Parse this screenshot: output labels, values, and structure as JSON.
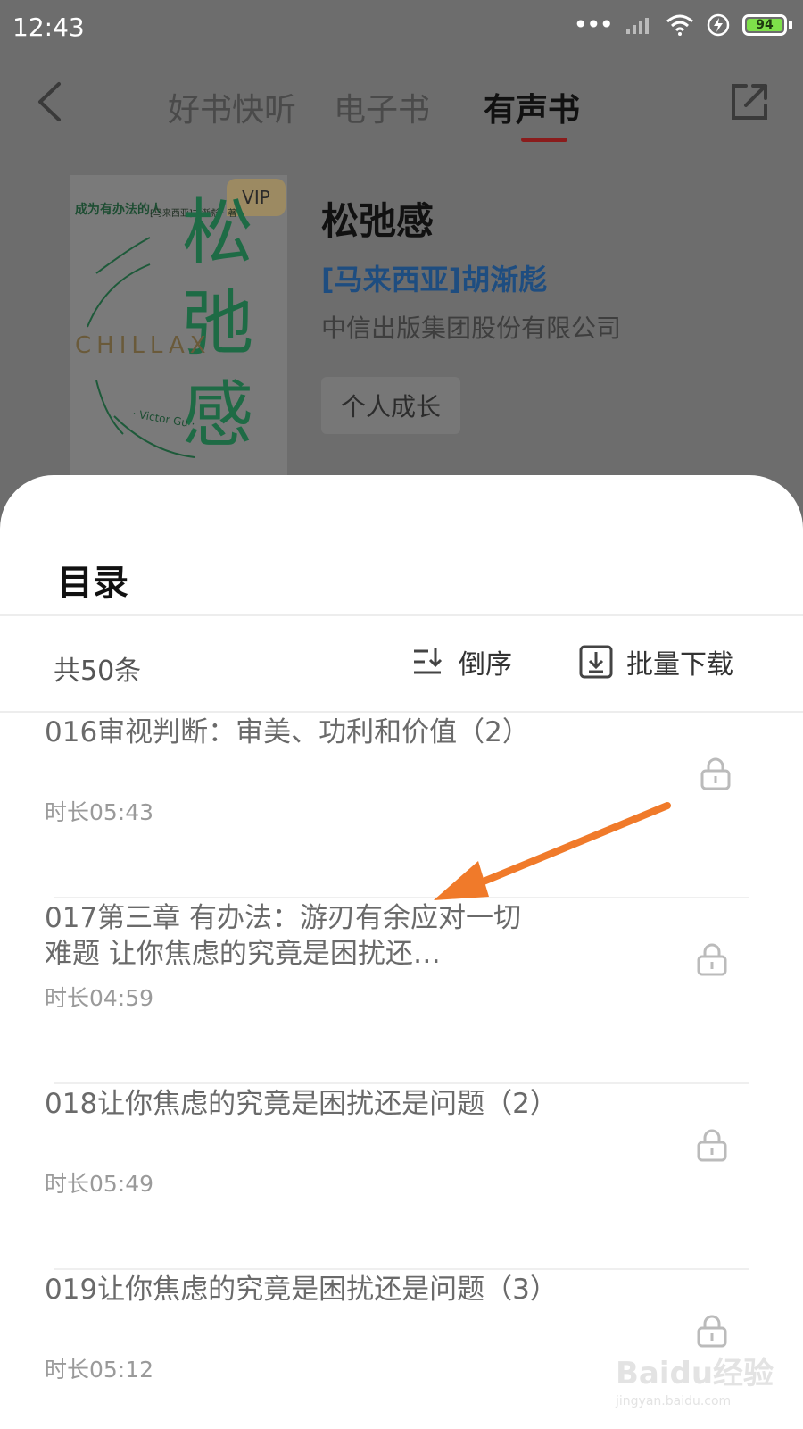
{
  "status_bar": {
    "time": "12:43",
    "battery": "94"
  },
  "nav": {
    "tabs": [
      {
        "label": "好书快听",
        "active": false
      },
      {
        "label": "电子书",
        "active": false
      },
      {
        "label": "有声书",
        "active": true
      }
    ]
  },
  "book": {
    "cover": {
      "vip": "VIP",
      "title_small": "成为有办法的人",
      "author_small": "[马来西亚]胡渐彪 · 著",
      "big_title": "松弛感",
      "english": "CHILLAX",
      "author_en": "· Victor Gu ·"
    },
    "title": "松弛感",
    "author": "[马来西亚]胡渐彪",
    "publisher": "中信出版集团股份有限公司",
    "tag": "个人成长"
  },
  "toc": {
    "title": "目录",
    "count": "共50条",
    "reverse_label": "倒序",
    "download_label": "批量下载",
    "items": [
      {
        "title": "016审视判断：审美、功利和价值（2）",
        "duration": "时长05:43"
      },
      {
        "title": "017第三章 有办法：游刃有余应对一切难题 让你焦虑的究竟是困扰还…",
        "duration": "时长04:59"
      },
      {
        "title": "018让你焦虑的究竟是困扰还是问题（2）",
        "duration": "时长05:49"
      },
      {
        "title": "019让你焦虑的究竟是困扰还是问题（3）",
        "duration": "时长05:12"
      }
    ]
  },
  "watermark": {
    "main": "Baidu经验",
    "sub": "jingyan.baidu.com"
  },
  "colors": {
    "accent": "#f07a2a",
    "tab_underline": "#8a1c1c",
    "author": "#1e4d80"
  }
}
